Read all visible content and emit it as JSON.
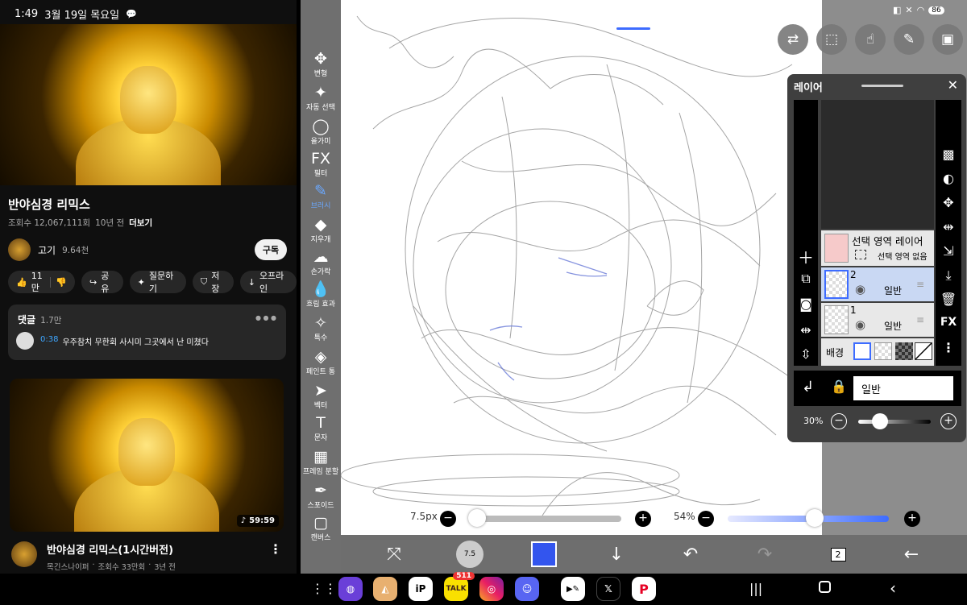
{
  "status": {
    "time": "1:49",
    "date": "3월 19일 목요일",
    "battery": "86"
  },
  "youtube": {
    "video_title": "반야심경 리믹스",
    "views": "조회수 12,067,111회",
    "age": "10년 전",
    "more": "더보기",
    "channel": "고기",
    "subscribers": "9.64천",
    "subscribe": "구독",
    "actions": {
      "like": "11만",
      "share": "공유",
      "ask": "질문하기",
      "save": "저장",
      "offline": "오프라인"
    },
    "comments": {
      "title": "댓글",
      "count": "1.7만",
      "timestamp": "0:38",
      "text": "우주참치 무한회 사시미 그곳에서 난 미쳤다"
    },
    "next": {
      "duration": "59:59",
      "title": "반야심경 리믹스(1시간버전)",
      "channel": "목긴스나이퍼",
      "views": "조회수 33만회",
      "age": "3년 전"
    }
  },
  "tools": [
    {
      "label": "변형",
      "icon": "move-icon",
      "glyph": "✥"
    },
    {
      "label": "자동 선택",
      "icon": "magic-wand-icon",
      "glyph": "✦"
    },
    {
      "label": "올가미",
      "icon": "lasso-icon",
      "glyph": "◯"
    },
    {
      "label": "필터",
      "icon": "fx-icon",
      "glyph": "FX"
    },
    {
      "label": "브러시",
      "icon": "brush-icon",
      "glyph": "✎"
    },
    {
      "label": "지우개",
      "icon": "eraser-icon",
      "glyph": "◆"
    },
    {
      "label": "손가락",
      "icon": "finger-icon",
      "glyph": "☁"
    },
    {
      "label": "흐림 효과",
      "icon": "drop-icon",
      "glyph": "💧"
    },
    {
      "label": "특수",
      "icon": "sparkle-icon",
      "glyph": "✧"
    },
    {
      "label": "페인트 통",
      "icon": "bucket-icon",
      "glyph": "◈"
    },
    {
      "label": "벡터",
      "icon": "cursor-icon",
      "glyph": "➤"
    },
    {
      "label": "문자",
      "icon": "text-icon",
      "glyph": "T"
    },
    {
      "label": "프레임 분할",
      "icon": "frame-icon",
      "glyph": "▦"
    },
    {
      "label": "스포이드",
      "icon": "eyedropper-icon",
      "glyph": "✒"
    },
    {
      "label": "캔버스",
      "icon": "canvas-icon",
      "glyph": "▢"
    }
  ],
  "active_tool": 4,
  "brush": {
    "size": "7.5px",
    "opacity": "54%",
    "size_level": 0.05,
    "opacity_level": 0.54,
    "thumb_value": "7.5"
  },
  "layers_panel": {
    "title": "레이어",
    "selection_layer": "선택 영역 레이어",
    "selection_none": "선택 영역 없음",
    "layers": [
      {
        "number": "2",
        "mode": "일반"
      },
      {
        "number": "1",
        "mode": "일반"
      }
    ],
    "background": "배경",
    "blend_mode": "일반",
    "opacity": "30%",
    "opacity_level": 0.3
  },
  "bottombar": {
    "layer_count": "2"
  },
  "dock": {
    "kakao_badge": "511"
  },
  "colors": {
    "accent": "#3d6cff",
    "brush_color": "#3355ee"
  }
}
